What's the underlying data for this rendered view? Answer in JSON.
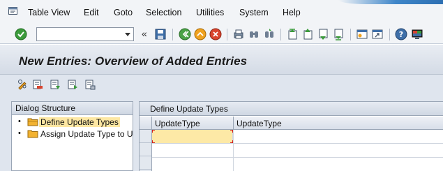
{
  "menu": {
    "items": [
      "Table View",
      "Edit",
      "Goto",
      "Selection",
      "Utilities",
      "System",
      "Help"
    ]
  },
  "toolbar": {
    "command_field_value": "",
    "chevron": "«",
    "icons": [
      "enter-icon",
      "save-icon",
      "back-icon",
      "exit-icon",
      "cancel-icon",
      "print-icon",
      "find-icon",
      "find-next-icon",
      "first-page-icon",
      "previous-page-icon",
      "next-page-icon",
      "last-page-icon",
      "create-session-icon",
      "shortcut-icon",
      "help-icon",
      "customize-layout-icon"
    ]
  },
  "title": "New Entries: Overview of Added Entries",
  "app_toolbar": {
    "icons": [
      "change-display-icon",
      "delete-icon",
      "select-all-icon",
      "select-block-icon",
      "deselect-all-icon"
    ]
  },
  "dialog_structure": {
    "header": "Dialog Structure",
    "items": [
      {
        "label": "Define Update Types",
        "selected": true
      },
      {
        "label": "Assign Update Type to U",
        "selected": false
      }
    ]
  },
  "table": {
    "caption": "Define Update Types",
    "columns": [
      "UpdateType",
      "UpdateType"
    ],
    "rows": [
      {
        "values": [
          "",
          ""
        ]
      },
      {
        "values": [
          "",
          ""
        ]
      },
      {
        "values": [
          "",
          ""
        ]
      }
    ]
  },
  "colors": {
    "accent": "#2d6fb2",
    "selected_input": "#fde9a6",
    "focus_marker": "#d01c1c"
  }
}
